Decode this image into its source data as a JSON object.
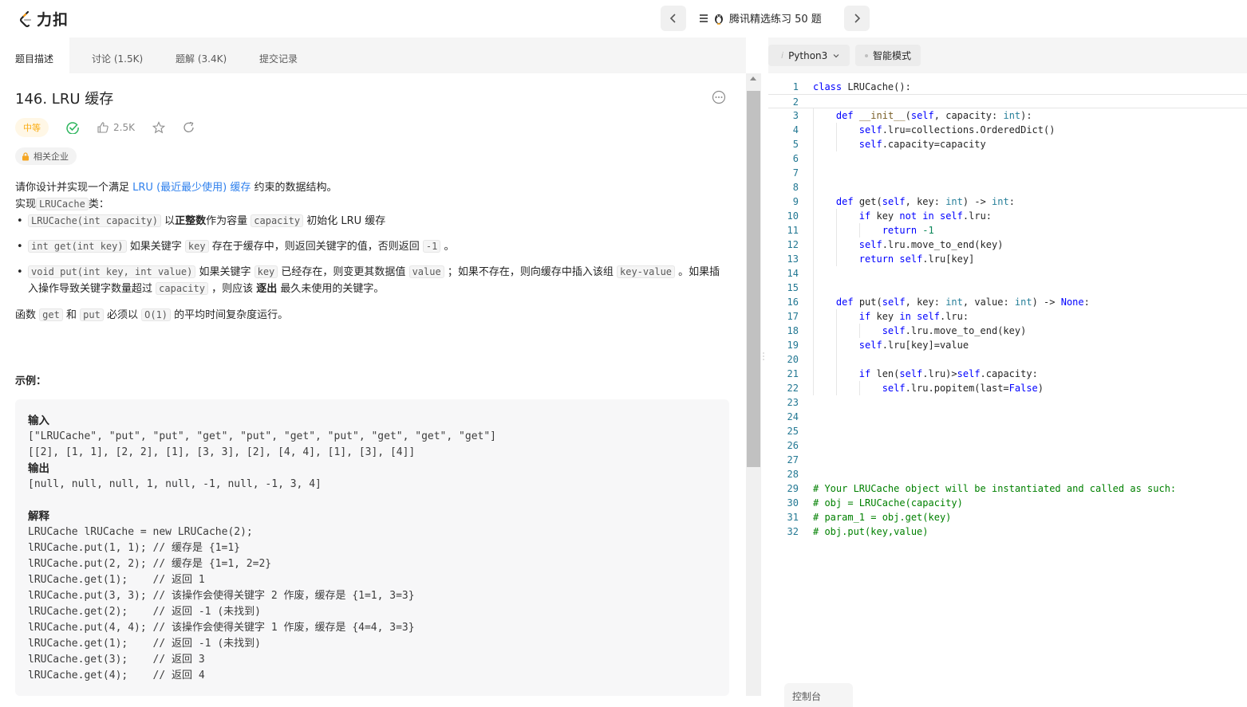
{
  "header": {
    "logo_text": "力扣",
    "study_plan": "腾讯精选练习 50 题"
  },
  "tabs": [
    {
      "label": "题目描述"
    },
    {
      "label": "讨论 (1.5K)"
    },
    {
      "label": "题解 (3.4K)"
    },
    {
      "label": "提交记录"
    }
  ],
  "problem": {
    "title": "146. LRU 缓存",
    "difficulty": "中等",
    "likes": "2.5K",
    "company_tag": "相关企业",
    "desc": {
      "intro_pre": "请你设计并实现一个满足",
      "intro_link": "LRU (最近最少使用) 缓存",
      "intro_post": "约束的数据结构。",
      "impl_pre": "实现",
      "impl_code": "LRUCache",
      "impl_post": "类：",
      "b1_code1": "LRUCache(int capacity)",
      "b1_t1": "以",
      "b1_bold": "正整数",
      "b1_t2": "作为容量",
      "b1_code2": "capacity",
      "b1_t3": "初始化 LRU 缓存",
      "b2_code1": "int get(int key)",
      "b2_t1": "如果关键字",
      "b2_code2": "key",
      "b2_t2": "存在于缓存中，则返回关键字的值，否则返回",
      "b2_code3": "-1",
      "b2_t3": "。",
      "b3_code1": "void put(int key, int value)",
      "b3_t1": "如果关键字",
      "b3_code2": "key",
      "b3_t2": "已经存在，则变更其数据值",
      "b3_code3": "value",
      "b3_t3": "；如果不存在，则向缓存中插入该组",
      "b3_code4": "key-value",
      "b3_t4": "。如果插入操作导致关键字数量超过",
      "b3_code5": "capacity",
      "b3_t5": "，则应该",
      "b3_bold": "逐出",
      "b3_t6": "最久未使用的关键字。",
      "fn_pre": "函数",
      "fn_code1": "get",
      "fn_t1": "和",
      "fn_code2": "put",
      "fn_t2": "必须以",
      "fn_code3": "O(1)",
      "fn_t3": "的平均时间复杂度运行。"
    },
    "example_title": "示例：",
    "example": {
      "input_label": "输入",
      "input_lines": [
        "[\"LRUCache\", \"put\", \"put\", \"get\", \"put\", \"get\", \"put\", \"get\", \"get\", \"get\"]",
        "[[2], [1, 1], [2, 2], [1], [3, 3], [2], [4, 4], [1], [3], [4]]"
      ],
      "output_label": "输出",
      "output_lines": [
        "[null, null, null, 1, null, -1, null, -1, 3, 4]"
      ],
      "explain_label": "解释",
      "explain_lines": [
        "LRUCache lRUCache = new LRUCache(2);",
        "lRUCache.put(1, 1); // 缓存是 {1=1}",
        "lRUCache.put(2, 2); // 缓存是 {1=1, 2=2}",
        "lRUCache.get(1);    // 返回 1",
        "lRUCache.put(3, 3); // 该操作会使得关键字 2 作废，缓存是 {1=1, 3=3}",
        "lRUCache.get(2);    // 返回 -1 (未找到)",
        "lRUCache.put(4, 4); // 该操作会使得关键字 1 作废，缓存是 {4=4, 3=3}",
        "lRUCache.get(1);    // 返回 -1 (未找到)",
        "lRUCache.get(3);    // 返回 3",
        "lRUCache.get(4);    // 返回 4"
      ]
    }
  },
  "editor": {
    "language": "Python3",
    "mode": "智能模式",
    "console_label": "控制台",
    "lines": [
      "class LRUCache():",
      "",
      "    def __init__(self, capacity: int):",
      "        self.lru=collections.OrderedDict()",
      "        self.capacity=capacity",
      "",
      "",
      "",
      "    def get(self, key: int) -> int:",
      "        if key not in self.lru:",
      "            return -1",
      "        self.lru.move_to_end(key)",
      "        return self.lru[key]",
      "",
      "",
      "    def put(self, key: int, value: int) -> None:",
      "        if key in self.lru:",
      "            self.lru.move_to_end(key)",
      "        self.lru[key]=value",
      "",
      "        if len(self.lru)>self.capacity:",
      "            self.lru.popitem(last=False)",
      "",
      "",
      "",
      "",
      "",
      "",
      "# Your LRUCache object will be instantiated and called as such:",
      "# obj = LRUCache(capacity)",
      "# param_1 = obj.get(key)",
      "# obj.put(key,value)"
    ]
  },
  "colors": {
    "link": "#2f80ed",
    "difficulty_medium": "#faad14",
    "accepted_green": "#2db55d"
  }
}
